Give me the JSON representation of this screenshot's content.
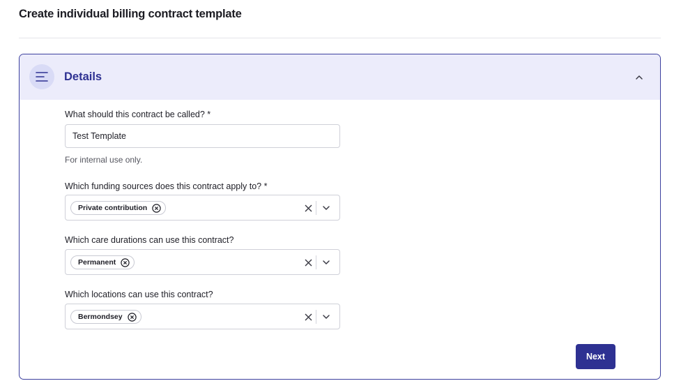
{
  "page": {
    "title": "Create individual billing contract template"
  },
  "section": {
    "title": "Details"
  },
  "fields": {
    "name": {
      "label": "What should this contract be called? *",
      "value": "Test Template",
      "helper": "For internal use only."
    },
    "funding": {
      "label": "Which funding sources does this contract apply to? *",
      "chip": "Private contribution"
    },
    "durations": {
      "label": "Which care durations can use this contract?",
      "chip": "Permanent"
    },
    "locations": {
      "label": "Which locations can use this contract?",
      "chip": "Bermondsey"
    }
  },
  "actions": {
    "next_label": "Next"
  },
  "colors": {
    "accent": "#2e3192",
    "header_bg": "#ececfb",
    "border": "#3b3f9e"
  },
  "icons": {
    "header": "menu-lines-icon",
    "collapse": "chevron-up-icon",
    "chip_remove": "circle-x-icon",
    "clear": "x-icon",
    "dropdown": "chevron-down-icon"
  }
}
